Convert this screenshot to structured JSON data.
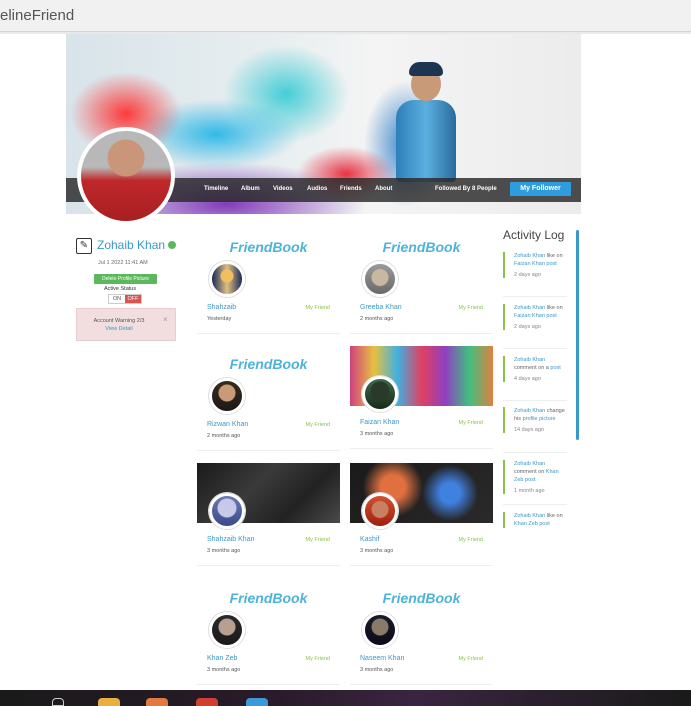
{
  "browser": {
    "tab_title": "elineFriend"
  },
  "profile": {
    "nav": [
      "Timeline",
      "Album",
      "Videos",
      "Audios",
      "Friends",
      "About"
    ],
    "followed_by": "Followed By 8 People",
    "follower_button": "My Follower",
    "name": "Zohaib Khan",
    "joined": "Jul 1 2022 11:41 AM",
    "delete_picture": "Delete Profile Picture",
    "active_status_label": "Active Status",
    "toggle_on": "ON",
    "toggle_off": "OFF",
    "warning": {
      "message": "Account Warning 2/3",
      "link": "View Detail",
      "close": "×"
    }
  },
  "friends": [
    {
      "name": "Shahzaib",
      "relation": "My Friend",
      "when": "Yesterday",
      "banner": "FriendBook"
    },
    {
      "name": "Greeba Khan",
      "relation": "My Friend",
      "when": "2 months ago",
      "banner": "FriendBook"
    },
    {
      "name": "Rizwan Khan",
      "relation": "My Friend",
      "when": "2 months ago",
      "banner": "FriendBook"
    },
    {
      "name": "Faizan Khan",
      "relation": "My Friend",
      "when": "3 months ago",
      "banner": ""
    },
    {
      "name": "Shahzaib Khan",
      "relation": "My Friend",
      "when": "3 months ago",
      "banner": ""
    },
    {
      "name": "Kashif",
      "relation": "My Friend",
      "when": "3 months ago",
      "banner": ""
    },
    {
      "name": "Khan Zeb",
      "relation": "My Friend",
      "when": "3 months ago",
      "banner": "FriendBook"
    },
    {
      "name": "Naseem Khan",
      "relation": "My Friend",
      "when": "3 months ago",
      "banner": "FriendBook"
    }
  ],
  "activity": {
    "title": "Activity Log",
    "items": [
      {
        "actor": "Zohaib Khan",
        "action": " like on ",
        "target": "Faizan Khan post",
        "ago": "2 days ago"
      },
      {
        "actor": "Zohaib Khan",
        "action": " like on ",
        "target": "Faizan Khan post",
        "ago": "2 days ago"
      },
      {
        "actor": "Zohaib Khan",
        "action": " comment on a ",
        "target": "post",
        "ago": "4 days ago"
      },
      {
        "actor": "Zohaib Khan",
        "action": " change his ",
        "target": "profile picture",
        "ago": "14 days ago"
      },
      {
        "actor": "Zohaib Khan",
        "action": " comment on ",
        "target": "Khan Zeb post",
        "ago": "1 month ago"
      },
      {
        "actor": "Zohaib Khan",
        "action": " like on ",
        "target": "Khan Zeb post",
        "ago": ""
      }
    ]
  }
}
